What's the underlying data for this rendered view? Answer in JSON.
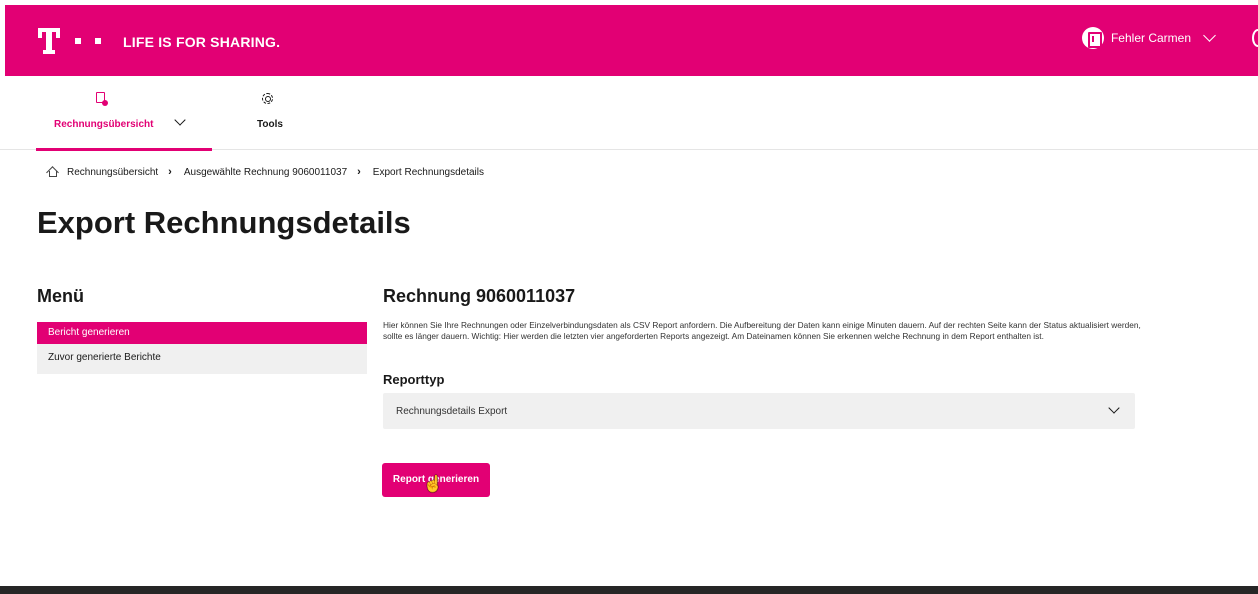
{
  "header": {
    "slogan": "LIFE IS FOR SHARING.",
    "user_name": "Fehler Carmen",
    "brand_color": "#e20074"
  },
  "nav": {
    "items": [
      {
        "label": "Rechnungsübersicht",
        "icon": "invoice-icon",
        "active": true
      },
      {
        "label": "Tools",
        "icon": "gear-icon",
        "active": false
      }
    ]
  },
  "breadcrumb": {
    "items": [
      "Rechnungsübersicht",
      "Ausgewählte Rechnung 9060011037",
      "Export Rechnungsdetails"
    ]
  },
  "page": {
    "title": "Export Rechnungsdetails"
  },
  "menu": {
    "title": "Menü",
    "items": [
      {
        "label": "Bericht generieren",
        "active": true
      },
      {
        "label": "Zuvor generierte Berichte",
        "active": false
      }
    ]
  },
  "main": {
    "section_title": "Rechnung 9060011037",
    "description": "Hier können Sie Ihre Rechnungen oder Einzelverbindungsdaten als CSV Report anfordern. Die Aufbereitung der Daten kann einige Minuten dauern. Auf der rechten Seite kann der Status aktualisiert werden, sollte es länger dauern. Wichtig: Hier werden die letzten vier angeforderten Reports angezeigt. Am Dateinamen können Sie erkennen welche Rechnung in dem Report enthalten ist.",
    "report_type_label": "Reporttyp",
    "report_type_value": "Rechnungsdetails Export",
    "generate_button": "Report generieren"
  }
}
